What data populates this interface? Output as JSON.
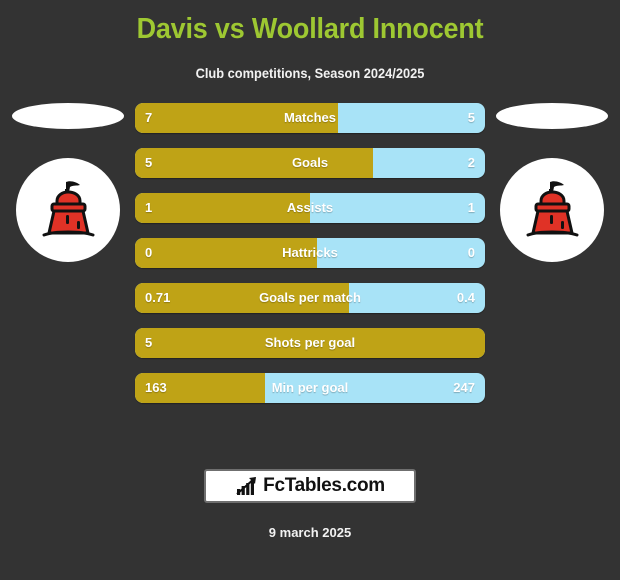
{
  "header": {
    "title": "Davis vs Woollard Innocent",
    "subtitle": "Club competitions, Season 2024/2025",
    "title_color": "#9ec832"
  },
  "colors": {
    "background": "#333333",
    "home_bar": "#bfa316",
    "away_bar": "#a8e3f7",
    "text": "#ffffff",
    "crest_primary": "#e03226"
  },
  "crests": {
    "left": {
      "logo_name": "davis-club-logo",
      "crest_name": "davis-club-crest"
    },
    "right": {
      "logo_name": "woollard-innocent-club-logo",
      "crest_name": "woollard-innocent-club-crest"
    }
  },
  "chart_data": {
    "type": "bar",
    "title": "Davis vs Woollard Innocent",
    "subtitle": "Club competitions, Season 2024/2025",
    "orientation": "horizontal-split",
    "categories": [
      "Matches",
      "Goals",
      "Assists",
      "Hattricks",
      "Goals per match",
      "Shots per goal",
      "Min per goal"
    ],
    "series": [
      {
        "name": "Davis",
        "values": [
          "7",
          "5",
          "1",
          "0",
          "0.71",
          "5",
          "163"
        ]
      },
      {
        "name": "Woollard Innocent",
        "values": [
          "5",
          "2",
          "1",
          "0",
          "0.4",
          "",
          "247"
        ]
      }
    ],
    "home_share_percent": [
      58,
      68,
      50,
      52,
      61,
      100,
      37
    ],
    "legend": "none",
    "grid": false
  },
  "stats": [
    {
      "label": "Matches",
      "home": "7",
      "away": "5",
      "home_percent": 58
    },
    {
      "label": "Goals",
      "home": "5",
      "away": "2",
      "home_percent": 68
    },
    {
      "label": "Assists",
      "home": "1",
      "away": "1",
      "home_percent": 50
    },
    {
      "label": "Hattricks",
      "home": "0",
      "away": "0",
      "home_percent": 52
    },
    {
      "label": "Goals per match",
      "home": "0.71",
      "away": "0.4",
      "home_percent": 61
    },
    {
      "label": "Shots per goal",
      "home": "5",
      "away": "",
      "home_percent": 100
    },
    {
      "label": "Min per goal",
      "home": "163",
      "away": "247",
      "home_percent": 37
    }
  ],
  "footer": {
    "brand": "FcTables.com",
    "brand_icon": "bar-chart-arrow-icon",
    "date": "9 march 2025"
  }
}
